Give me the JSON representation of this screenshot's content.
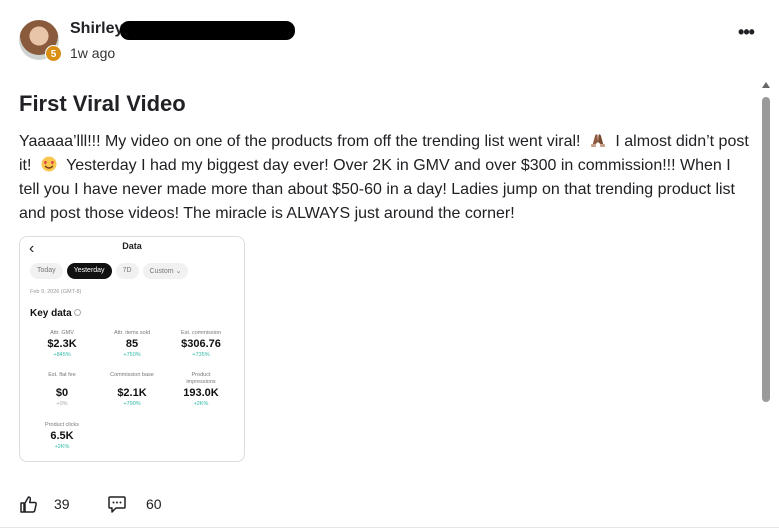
{
  "post": {
    "author": {
      "name": "Shirley",
      "level": "5",
      "avatar_icon": "avatar-photo"
    },
    "timestamp": "1w ago",
    "menu_icon": "more-horizontal-icon",
    "title": "First Viral Video",
    "body": {
      "part1": "Yaaaaa’lll!!! My video on one of the products from off the trending list went viral!",
      "emoji1": "praying-hands-emoji",
      "part2": "I almost didn’t post it!",
      "emoji2": "heart-eyes-emoji",
      "part3": "Yesterday I had my biggest day ever! Over 2K in GMV and over $300 in commission!!! When I tell you I have never made more than about $50-60 in a day! Ladies jump on that trending product list and post those videos! The miracle is ALWAYS just around the corner!"
    },
    "attachment": {
      "header_title": "Data",
      "tabs": [
        "Today",
        "Yesterday",
        "7D",
        "Custom ⌄"
      ],
      "active_tab": "Yesterday",
      "date": "Feb 9, 2026 (GMT-8)",
      "section_title": "Key data",
      "metrics": [
        {
          "label": "Attr. GMV",
          "value": "$2.3K",
          "change": "+845%"
        },
        {
          "label": "Attr. items sold",
          "value": "85",
          "change": "+750%"
        },
        {
          "label": "Est. commission",
          "value": "$306.76",
          "change": "+735%"
        },
        {
          "label": "Est. flat fee",
          "value": "$0",
          "change": "+0%"
        },
        {
          "label": "Commission base",
          "value": "$2.1K",
          "change": "+790%"
        },
        {
          "label": "Product impressions",
          "value": "193.0K",
          "change": "+2K%"
        },
        {
          "label": "Product clicks",
          "value": "6.5K",
          "change": "+2K%"
        }
      ],
      "accent_color": "#30b8a8"
    },
    "reactions": {
      "like_icon": "thumbs-up-icon",
      "like_count": "39",
      "comment_icon": "comment-icon",
      "comment_count": "60"
    }
  },
  "colors": {
    "text": "#202124",
    "badge": "#d98f14",
    "scrollbar": "#9a9a9a"
  }
}
